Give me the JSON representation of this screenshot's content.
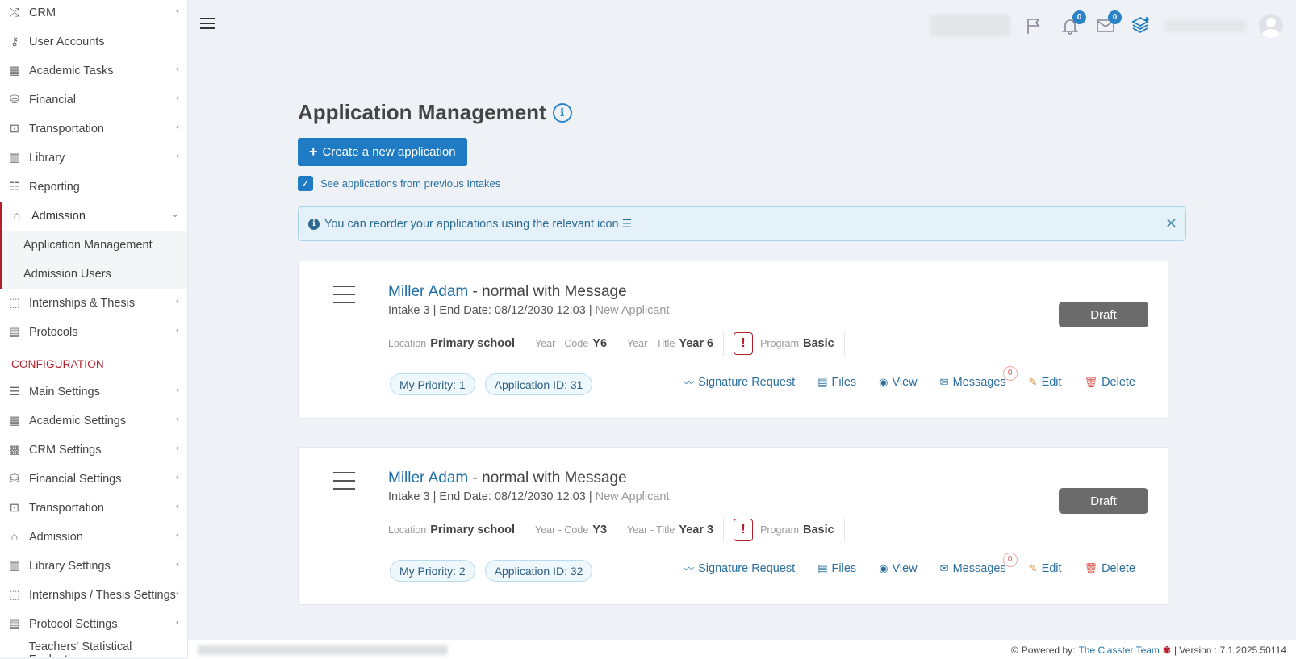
{
  "sidebar": {
    "items_top": [
      {
        "label": "CRM",
        "icon": "shuffle-icon",
        "glyph": "⤮",
        "chevron": true
      },
      {
        "label": "User Accounts",
        "icon": "key-icon",
        "glyph": "⚷",
        "chevron": false
      },
      {
        "label": "Academic Tasks",
        "icon": "grid-icon",
        "glyph": "▦",
        "chevron": true
      },
      {
        "label": "Financial",
        "icon": "coins-icon",
        "glyph": "⛁",
        "chevron": true
      },
      {
        "label": "Transportation",
        "icon": "bus-icon",
        "glyph": "⊡",
        "chevron": true
      },
      {
        "label": "Library",
        "icon": "books-icon",
        "glyph": "▥",
        "chevron": true
      },
      {
        "label": "Reporting",
        "icon": "report-icon",
        "glyph": "☷",
        "chevron": false
      }
    ],
    "admission": {
      "label": "Admission",
      "icon": "institution-icon",
      "glyph": "⌂"
    },
    "admission_sub": [
      "Application Management",
      "Admission Users"
    ],
    "items_mid": [
      {
        "label": "Internships & Thesis",
        "icon": "cube-icon",
        "glyph": "⬚",
        "chevron": true
      },
      {
        "label": "Protocols",
        "icon": "calendar-icon",
        "glyph": "▤",
        "chevron": true
      }
    ],
    "config_heading": "CONFIGURATION",
    "items_config": [
      {
        "label": "Main Settings",
        "icon": "sliders-icon",
        "glyph": "☰",
        "chevron": true
      },
      {
        "label": "Academic Settings",
        "icon": "grid-icon",
        "glyph": "▦",
        "chevron": true
      },
      {
        "label": "CRM Settings",
        "icon": "tiles-icon",
        "glyph": "▩",
        "chevron": true
      },
      {
        "label": "Financial Settings",
        "icon": "coins-icon",
        "glyph": "⛁",
        "chevron": true
      },
      {
        "label": "Transportation",
        "icon": "bus-icon",
        "glyph": "⊡",
        "chevron": true
      },
      {
        "label": "Admission",
        "icon": "institution-icon",
        "glyph": "⌂",
        "chevron": true
      },
      {
        "label": "Library Settings",
        "icon": "books-icon",
        "glyph": "▥",
        "chevron": true
      },
      {
        "label": "Internships / Thesis Settings",
        "icon": "cube-icon",
        "glyph": "⬚",
        "chevron": true
      },
      {
        "label": "Protocol Settings",
        "icon": "calendar-icon",
        "glyph": "▤",
        "chevron": true
      },
      {
        "label": "Teachers' Statistical Evaluation",
        "icon": "",
        "glyph": "",
        "chevron": false
      }
    ]
  },
  "topbar": {
    "notifications_count": "0",
    "messages_count": "0"
  },
  "main": {
    "title": "Application Management",
    "create_button": "Create a new application",
    "checkbox_label": "See applications from previous Intakes",
    "alert_text": "You can reorder your applications using the relevant icon"
  },
  "applications": [
    {
      "name": "Miller Adam",
      "title_rest": " - normal with Message",
      "intake": "Intake 3 | End Date: 08/12/2030 12:03 | ",
      "applicant_type": "New Applicant",
      "location_label": "Location",
      "location": "Primary school",
      "year_code_label": "Year - Code",
      "year_code": "Y6",
      "year_title_label": "Year - Title",
      "year_title": "Year 6",
      "program_label": "Program",
      "program": "Basic",
      "priority": "My Priority: 1",
      "app_id": "Application ID: 31",
      "status": "Draft",
      "messages_count": "0"
    },
    {
      "name": "Miller Adam",
      "title_rest": " - normal with Message",
      "intake": "Intake 3 | End Date: 08/12/2030 12:03 | ",
      "applicant_type": "New Applicant",
      "location_label": "Location",
      "location": "Primary school",
      "year_code_label": "Year - Code",
      "year_code": "Y3",
      "year_title_label": "Year - Title",
      "year_title": "Year 3",
      "program_label": "Program",
      "program": "Basic",
      "priority": "My Priority: 2",
      "app_id": "Application ID: 32",
      "status": "Draft",
      "messages_count": "0"
    }
  ],
  "actions": {
    "signature": "Signature Request",
    "files": "Files",
    "view": "View",
    "messages": "Messages",
    "edit": "Edit",
    "delete": "Delete"
  },
  "footer": {
    "powered_by": "Powered by:",
    "team": "The Classter Team",
    "version": "| Version : 7.1.2025.50114"
  },
  "colors": {
    "accent": "#1f7cc4",
    "brand_red": "#b3202a",
    "draft": "#6b6b6b"
  }
}
